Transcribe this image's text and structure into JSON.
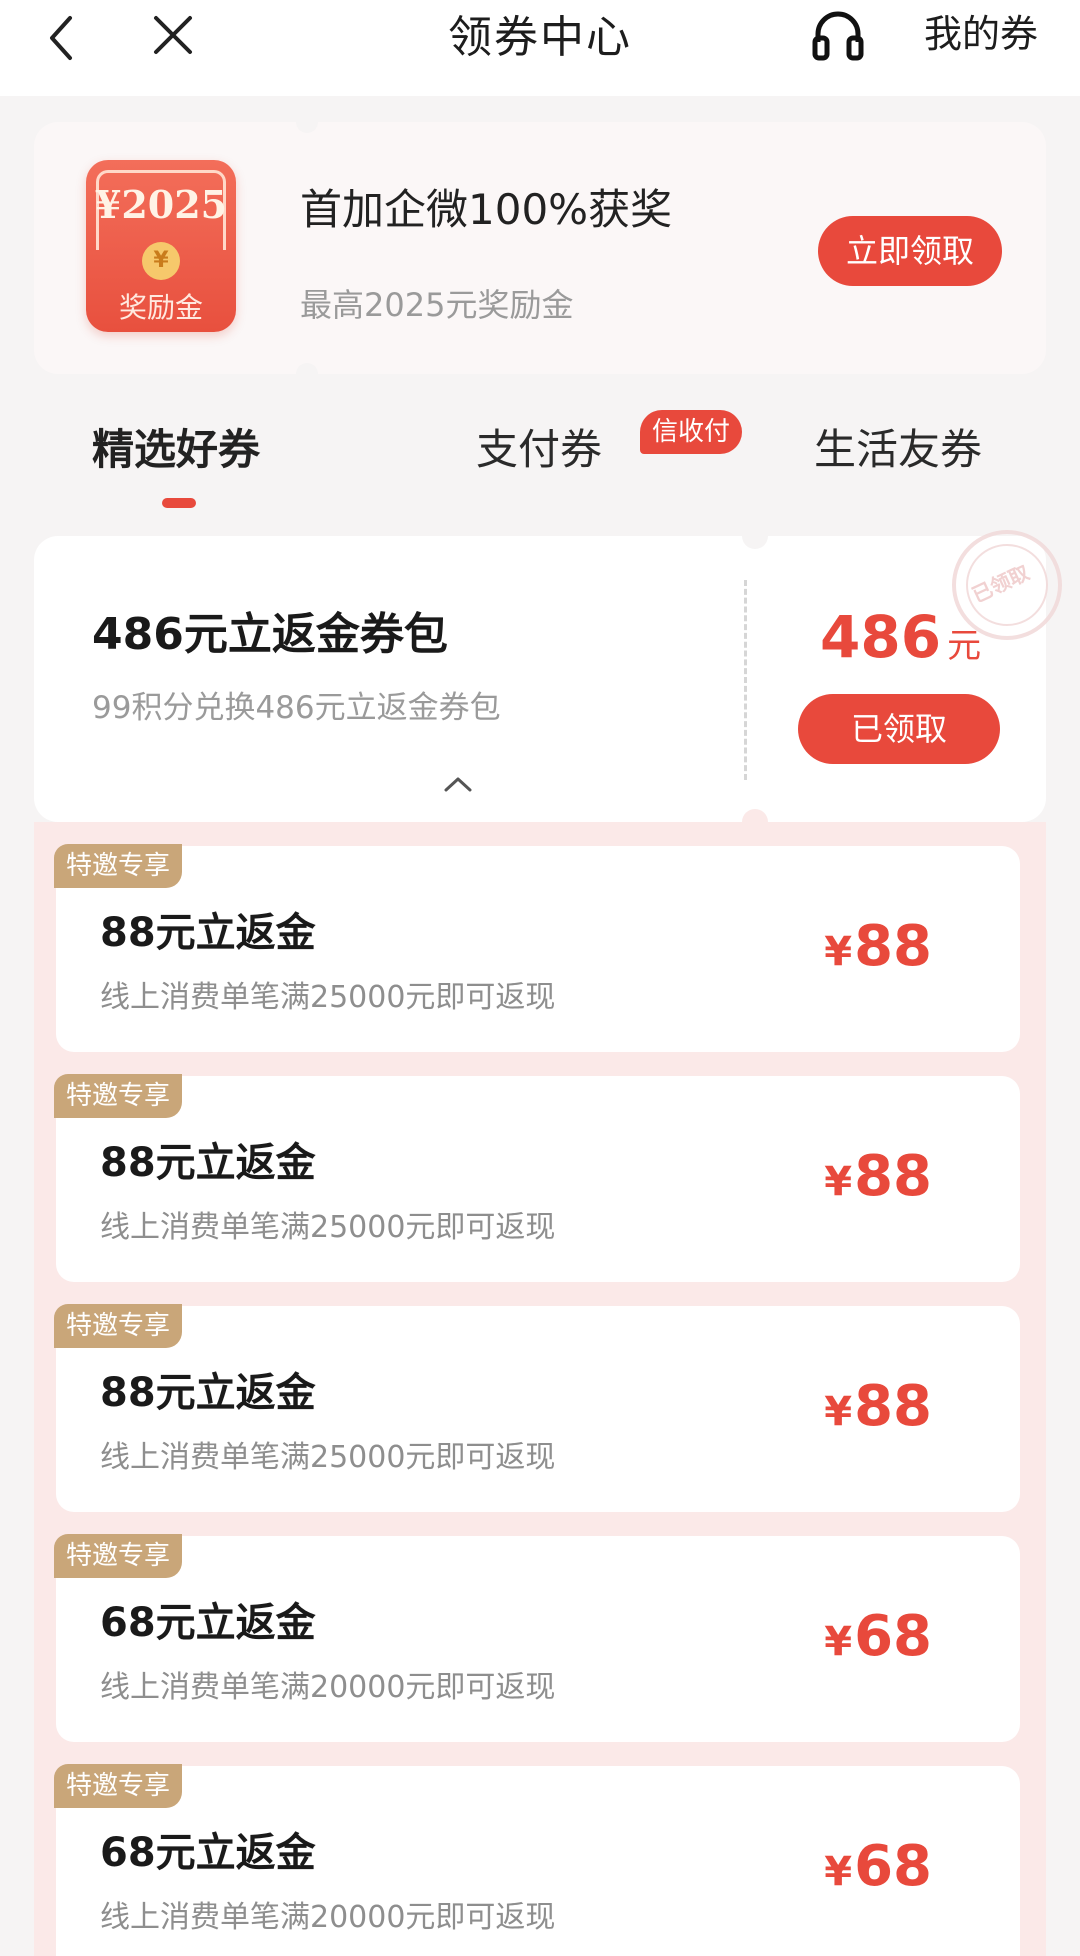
{
  "header": {
    "title": "领券中心",
    "my_coupons": "我的券"
  },
  "promo": {
    "envelope_amount": "¥2025",
    "envelope_label": "奖励金",
    "title": "首加企微100%获奖",
    "subtitle": "最高2025元奖励金",
    "button": "立即领取"
  },
  "tabs": [
    {
      "label": "精选好券",
      "active": true
    },
    {
      "label": "支付券",
      "badge": "信收付"
    },
    {
      "label": "生活友券"
    }
  ],
  "pack": {
    "title": "486元立返金券包",
    "subtitle": "99积分兑换486元立返金券包",
    "amount": "486",
    "unit": "元",
    "button": "已领取",
    "stamp": "已领取"
  },
  "coupons": [
    {
      "tag": "特邀专享",
      "title": "88元立返金",
      "subtitle": "线上消费单笔满25000元即可返现",
      "yen": "¥",
      "amount": "88"
    },
    {
      "tag": "特邀专享",
      "title": "88元立返金",
      "subtitle": "线上消费单笔满25000元即可返现",
      "yen": "¥",
      "amount": "88"
    },
    {
      "tag": "特邀专享",
      "title": "88元立返金",
      "subtitle": "线上消费单笔满25000元即可返现",
      "yen": "¥",
      "amount": "88"
    },
    {
      "tag": "特邀专享",
      "title": "68元立返金",
      "subtitle": "线上消费单笔满20000元即可返现",
      "yen": "¥",
      "amount": "68"
    },
    {
      "tag": "特邀专享",
      "title": "68元立返金",
      "subtitle": "线上消费单笔满20000元即可返现",
      "yen": "¥",
      "amount": "68"
    }
  ],
  "colors": {
    "accent": "#e8493c",
    "tag": "#c9a679",
    "list_background": "#fbe9e8"
  }
}
